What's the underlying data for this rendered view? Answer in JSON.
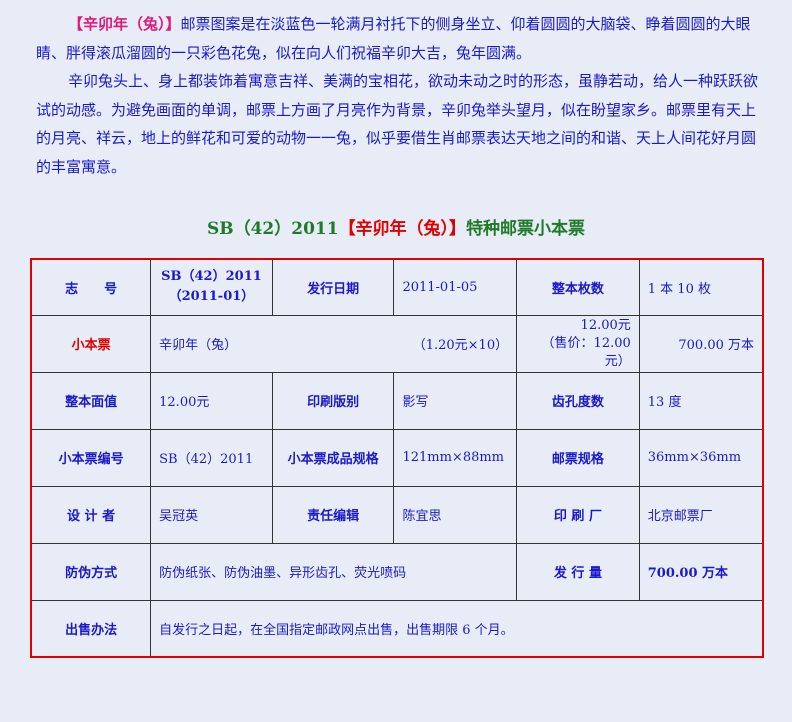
{
  "intro": {
    "highlight": "【辛卯年（兔）】",
    "p1_rest": "邮票图案是在淡蓝色一轮满月衬托下的侧身坐立、仰着圆圆的大脑袋、睁着圆圆的大眼睛、胖得滚瓜溜圆的一只彩色花兔，似在向人们祝福辛卯大吉，兔年圆满。",
    "p2": "辛卯兔头上、身上都装饰着寓意吉祥、美满的宝相花，欲动未动之时的形态，虽静若动，给人一种跃跃欲试的动感。为避免画面的单调，邮票上方画了月亮作为背景，辛卯兔举头望月，似在盼望家乡。邮票里有天上的月亮、祥云，地上的鲜花和可爱的动物一一兔，似乎要借生肖邮票表达天地之间的和谐、天上人间花好月圆的丰富寓意。"
  },
  "title": {
    "prefix": "SB（42）2011",
    "name": "【辛卯年（兔）】",
    "suffix": "特种邮票小本票"
  },
  "table": {
    "r1": {
      "l1": "志　　号",
      "v1a": "SB（42）2011",
      "v1b": "（2011-01）",
      "l2": "发行日期",
      "v2": "2011-01-05",
      "l3": "整本枚数",
      "v3": "1 本 10 枚"
    },
    "r2": {
      "l1": "小本票",
      "name": "辛卯年（兔）",
      "price": "（1.20元×10）",
      "v2a": "12.00元",
      "v2b": "（售价：12.00元）",
      "v3": "700.00 万本"
    },
    "r3": {
      "l1": "整本面值",
      "v1": "12.00元",
      "l2": "印刷版别",
      "v2": "影写",
      "l3": "齿孔度数",
      "v3": "13 度"
    },
    "r4": {
      "l1": "小本票编号",
      "v1": "SB（42）2011",
      "l2": "小本票成品规格",
      "v2": "121mm×88mm",
      "l3": "邮票规格",
      "v3": "36mm×36mm"
    },
    "r5": {
      "l1": "设 计 者",
      "v1": "吴冠英",
      "l2": "责任编辑",
      "v2": "陈宜思",
      "l3": "印 刷 厂",
      "v3": "北京邮票厂"
    },
    "r6": {
      "l1": "防伪方式",
      "v1": "防伪纸张、防伪油墨、异形齿孔、荧光喷码",
      "l2": "发 行 量",
      "v2": "700.00 万本"
    },
    "r7": {
      "l1": "出售办法",
      "v1": "自发行之日起，在全国指定邮政网点出售，出售期限 6 个月。"
    }
  },
  "colors": {
    "text_blue": "#1a1acc",
    "label_green": "#1f7a2a",
    "accent_red": "#e00000",
    "highlight_magenta": "#e0197a",
    "background": "#e8ecf6"
  }
}
